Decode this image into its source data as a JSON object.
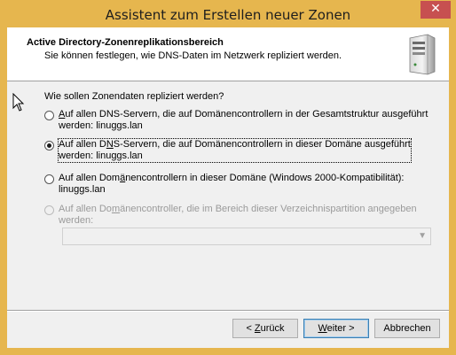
{
  "window": {
    "title": "Assistent zum Erstellen neuer Zonen",
    "close_glyph": "✕"
  },
  "header": {
    "title": "Active Directory-Zonenreplikationsbereich",
    "subtitle": "Sie können festlegen, wie DNS-Daten im Netzwerk repliziert werden.",
    "icon": "server-icon"
  },
  "question": "Wie sollen Zonendaten repliziert werden?",
  "options": [
    {
      "line1_pre": "",
      "mnemonic": "A",
      "line1_post": "uf allen DNS-Servern, die auf Domänencontrollern in der Gesamtstruktur ausgeführt",
      "line2": "werden: linuggs.lan",
      "selected": false,
      "enabled": true
    },
    {
      "line1_pre": "Auf allen D",
      "mnemonic": "N",
      "line1_post": "S-Servern, die auf Domänencontrollern in dieser Domäne ausgeführt",
      "line2": "werden: linuggs.lan",
      "selected": true,
      "enabled": true
    },
    {
      "line1_pre": "Auf allen Dom",
      "mnemonic": "ä",
      "line1_post": "nencontrollern in dieser Domäne (Windows 2000-Kompatibilität):",
      "line2": "linuggs.lan",
      "selected": false,
      "enabled": true
    },
    {
      "line1_pre": "Auf allen Do",
      "mnemonic": "m",
      "line1_post": "änencontroller, die im Bereich dieser Verzeichnispartition angegeben",
      "line2": "werden:",
      "selected": false,
      "enabled": false
    }
  ],
  "partition_select": {
    "value": "",
    "enabled": false
  },
  "buttons": {
    "back_pre": "< ",
    "back_mn": "Z",
    "back_post": "urück",
    "next_mn": "W",
    "next_post": "eiter >",
    "cancel": "Abbrechen"
  }
}
